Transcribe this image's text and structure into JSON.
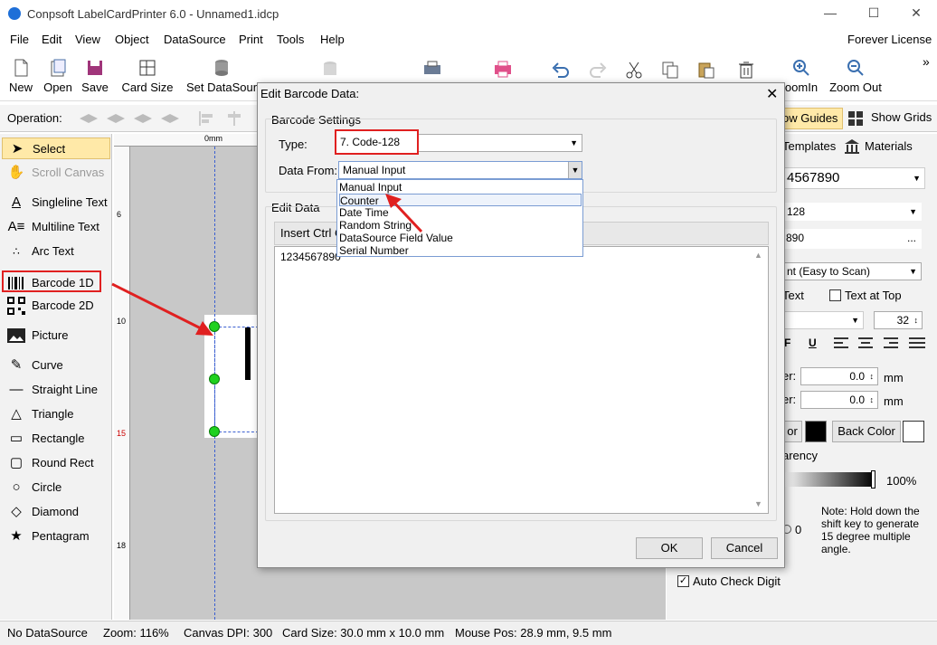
{
  "window": {
    "title": "Conpsoft LabelCardPrinter 6.0 - Unnamed1.idcp",
    "minimize": "—",
    "maximize": "☐",
    "close": "✕"
  },
  "menu": [
    "File",
    "Edit",
    "View",
    "Object",
    "DataSource",
    "Print",
    "Tools",
    "Help"
  ],
  "license": "Forever License",
  "toolbar": {
    "new": "New",
    "open": "Open",
    "save": "Save",
    "card_size": "Card Size",
    "set_datasource": "Set DataSour",
    "zoom_in": "oomIn",
    "zoom_out": "Zoom Out",
    "more": "»"
  },
  "operation_label": "Operation:",
  "show_guides": "ow Guides",
  "show_grids": "Show Grids",
  "tools": [
    {
      "label": "Select",
      "icon": "arrow-cursor-icon"
    },
    {
      "label": "Scroll Canvas",
      "icon": "hand-icon"
    },
    {
      "label": "Singleline Text",
      "icon": "singleline-text-icon"
    },
    {
      "label": "Multiline Text",
      "icon": "multiline-text-icon"
    },
    {
      "label": "Arc Text",
      "icon": "arc-text-icon"
    },
    {
      "label": "Barcode 1D",
      "icon": "barcode-icon"
    },
    {
      "label": "Barcode 2D",
      "icon": "qrcode-icon"
    },
    {
      "label": "Picture",
      "icon": "picture-icon"
    },
    {
      "label": "Curve",
      "icon": "curve-icon"
    },
    {
      "label": "Straight Line",
      "icon": "line-icon"
    },
    {
      "label": "Triangle",
      "icon": "triangle-icon"
    },
    {
      "label": "Rectangle",
      "icon": "rectangle-icon"
    },
    {
      "label": "Round Rect",
      "icon": "round-rect-icon"
    },
    {
      "label": "Circle",
      "icon": "circle-icon"
    },
    {
      "label": "Diamond",
      "icon": "diamond-icon"
    },
    {
      "label": "Pentagram",
      "icon": "star-icon"
    }
  ],
  "ruler": {
    "top_zero": "0mm",
    "marks": [
      "6",
      "10",
      "15",
      "18"
    ]
  },
  "right": {
    "tab_templates": "Templates",
    "tab_materials": "Materials",
    "data_value": "4567890",
    "type_value": "128",
    "data_short": "890",
    "ellipsis": "...",
    "font_style": "nt (Easy to Scan)",
    "show_text": "Text",
    "text_at_top": "Text at Top",
    "font_size": "32",
    "bold_glyph": "F",
    "underline_glyph": "U",
    "offset_label_1": "er:",
    "offset_value_1": "0.0",
    "offset_label_2": "er:",
    "offset_value_2": "0.0",
    "unit_mm": "mm",
    "fore_color_label": "or",
    "back_color": "Back Color",
    "transparency": "arency",
    "transparency_value": "100%",
    "rotate_value": "0",
    "note": "Note: Hold down the shift key to generate 15 degree multiple angle.",
    "auto_check_digit": "Auto Check Digit"
  },
  "dialog": {
    "title": "Edit Barcode Data:",
    "close": "✕",
    "settings_group": "Barcode Settings",
    "type_label": "Type:",
    "type_value": "7.  Code-128",
    "data_from_label": "Data From:",
    "data_from_value": "Manual Input",
    "edit_group": "Edit Data",
    "insert_ctrl": "Insert Ctrl C",
    "edit_text": "1234567890",
    "ok": "OK",
    "cancel": "Cancel",
    "dropdown_options": [
      "Manual Input",
      "Counter",
      "Date Time",
      "Random String",
      "DataSource Field Value",
      "Serial Number"
    ]
  },
  "status": {
    "datasource": "No DataSource",
    "zoom": "Zoom: 116%",
    "dpi": "Canvas DPI: 300",
    "card_size": "Card Size: 30.0 mm x 10.0 mm",
    "mouse_pos": "Mouse Pos: 28.9 mm, 9.5 mm"
  },
  "colors": {
    "accent_red": "#e02020",
    "handle_green": "#1fd11f",
    "selection_blue": "#3399ff",
    "fore_color": "#000000",
    "back_color": "#ffffff"
  }
}
